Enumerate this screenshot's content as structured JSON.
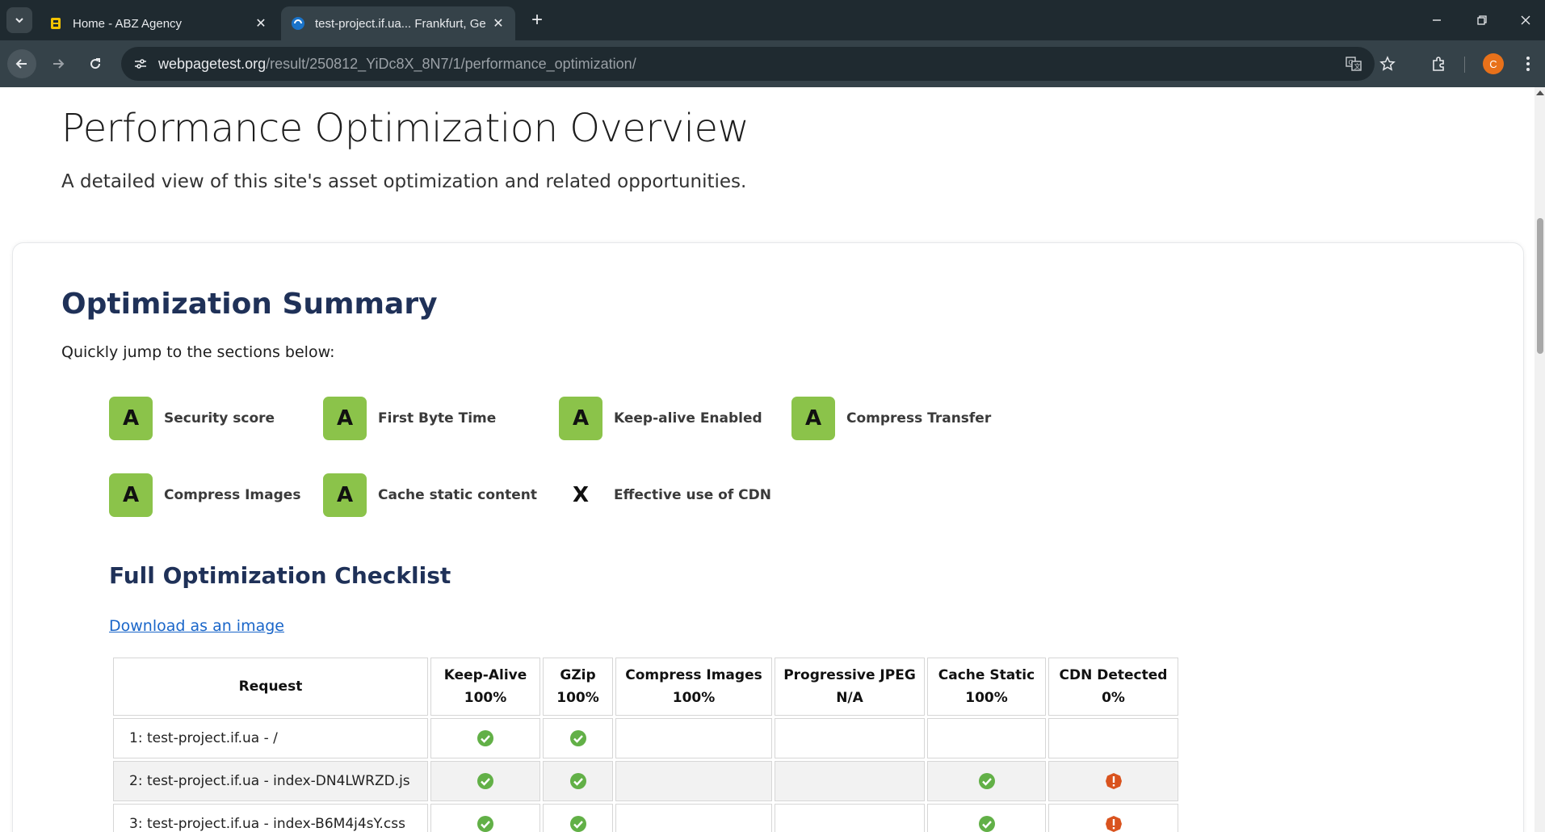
{
  "browser": {
    "tabs": [
      {
        "title": "Home - ABZ Agency",
        "active": false,
        "favicon": "abz-favicon-icon"
      },
      {
        "title": "test-project.if.ua... Frankfurt, Ge",
        "active": true,
        "favicon": "webpagetest-favicon-icon"
      }
    ],
    "url_host": "webpagetest.org",
    "url_path": "/result/250812_YiDc8X_8N7/1/performance_optimization/",
    "profile_initial": "C",
    "accent_colors": {
      "profile": "#e8711a",
      "grade_good": "#8bc34a",
      "check_ok": "#62b047",
      "check_warn": "#d9531e"
    }
  },
  "page": {
    "title": "Performance Optimization Overview",
    "subtitle": "A detailed view of this site's asset optimization and related opportunities.",
    "summary": {
      "title": "Optimization Summary",
      "intro": "Quickly jump to the sections below:",
      "grades": [
        {
          "grade": "A",
          "label": "Security score"
        },
        {
          "grade": "A",
          "label": "First Byte Time"
        },
        {
          "grade": "A",
          "label": "Keep-alive Enabled"
        },
        {
          "grade": "A",
          "label": "Compress Transfer"
        },
        {
          "grade": "A",
          "label": "Compress Images"
        },
        {
          "grade": "A",
          "label": "Cache static content"
        },
        {
          "grade": "X",
          "label": "Effective use of CDN"
        }
      ]
    },
    "checklist": {
      "title": "Full Optimization Checklist",
      "download_label": "Download as an image",
      "columns": [
        {
          "name": "Request",
          "value": ""
        },
        {
          "name": "Keep-Alive",
          "value": "100%"
        },
        {
          "name": "GZip",
          "value": "100%"
        },
        {
          "name": "Compress Images",
          "value": "100%"
        },
        {
          "name": "Progressive JPEG",
          "value": "N/A"
        },
        {
          "name": "Cache Static",
          "value": "100%"
        },
        {
          "name": "CDN Detected",
          "value": "0%"
        }
      ],
      "rows": [
        {
          "request": "1: test-project.if.ua - /",
          "cells": [
            "ok",
            "ok",
            "",
            "",
            "",
            ""
          ]
        },
        {
          "request": "2: test-project.if.ua - index-DN4LWRZD.js",
          "cells": [
            "ok",
            "ok",
            "",
            "",
            "ok",
            "warn"
          ]
        },
        {
          "request": "3: test-project.if.ua - index-B6M4j4sY.css",
          "cells": [
            "ok",
            "ok",
            "",
            "",
            "ok",
            "warn"
          ]
        }
      ]
    }
  }
}
